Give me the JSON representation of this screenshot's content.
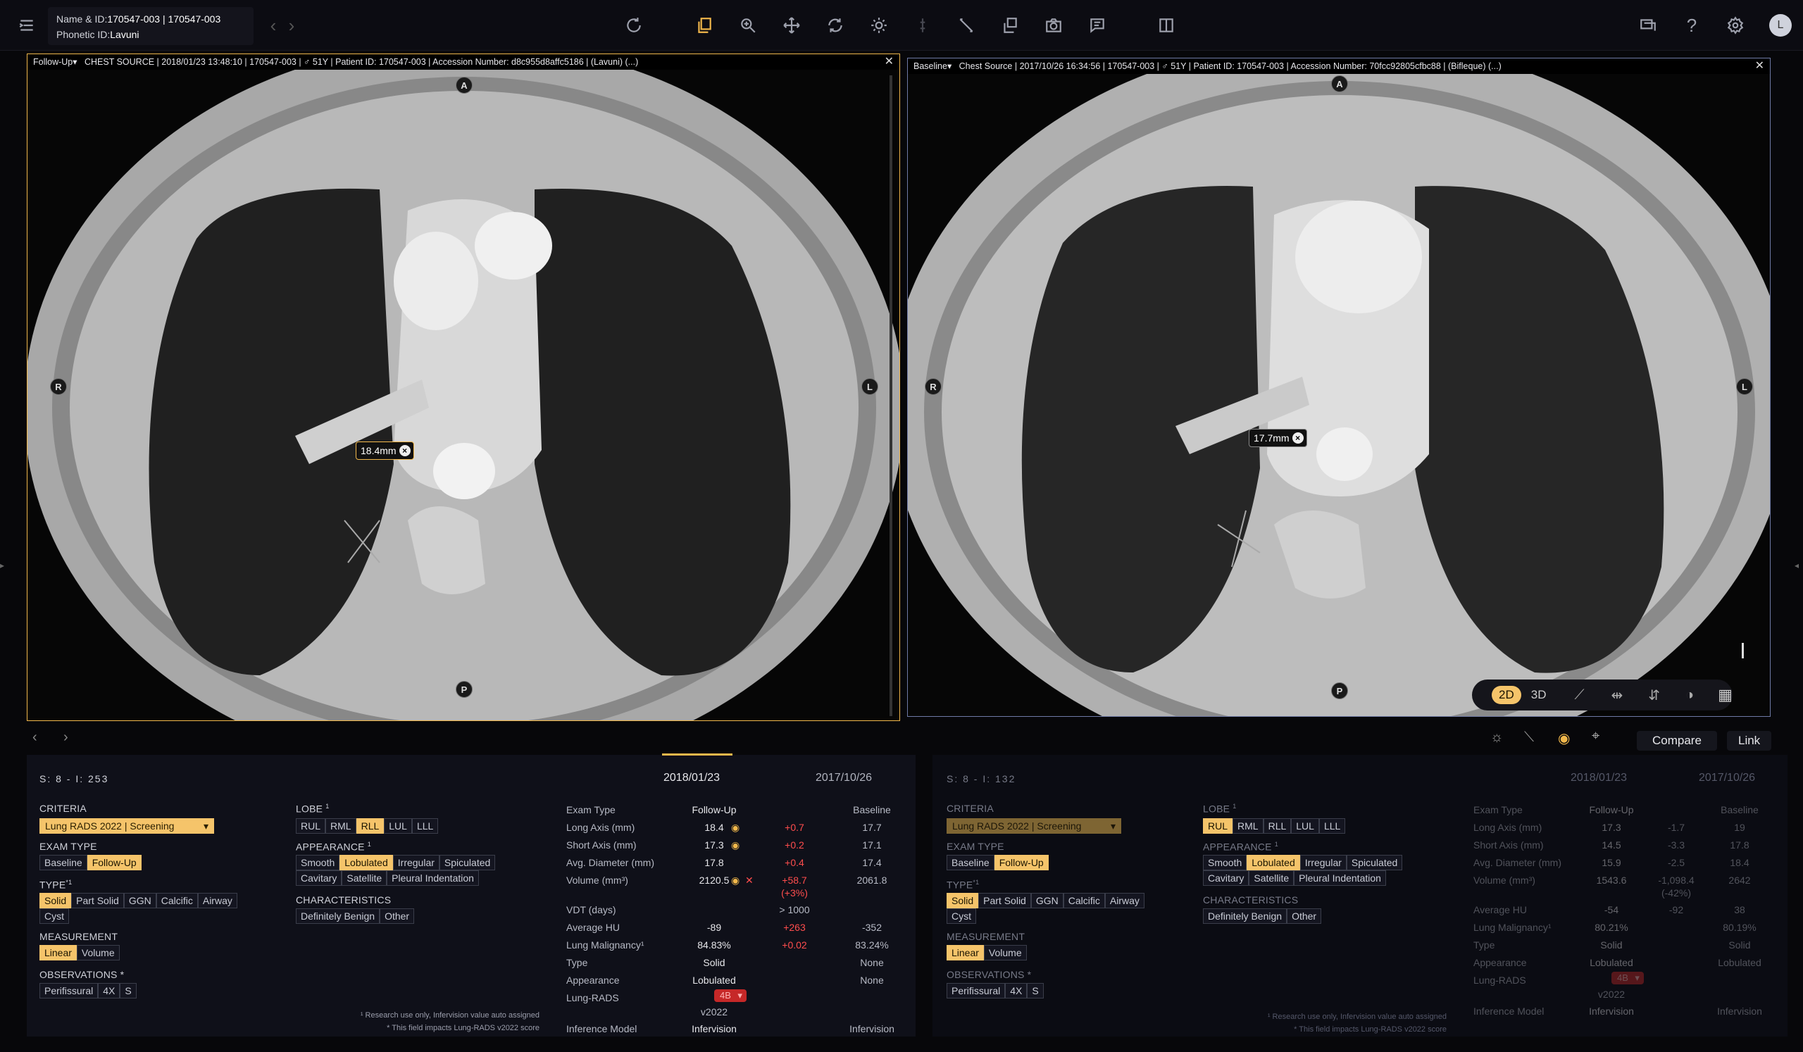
{
  "header": {
    "name_label": "Name & ID:",
    "name_value": "170547-003 | 170547-003",
    "phonetic_label": "Phonetic ID:",
    "phonetic_value": "Lavuni",
    "user_initial": "L"
  },
  "viewers": {
    "left": {
      "tag": "Follow-Up",
      "info": "CHEST SOURCE | 2018/01/23 13:48:10 | 170547-003 | ♂ 51Y | Patient ID: 170547-003 | Accession Number: d8c955d8affc5186 | (Lavuni) (...)",
      "measure": "18.4mm",
      "orient": {
        "top": "A",
        "bottom": "P",
        "left": "R",
        "right": "L"
      }
    },
    "right": {
      "tag": "Baseline",
      "info": "Chest Source | 2017/10/26 16:34:56 | 170547-003 | ♂ 51Y | Patient ID: 170547-003 | Accession Number: 70fcc92805cfbc88 | (Bifleque) (...)",
      "measure": "17.7mm",
      "orient": {
        "top": "A",
        "bottom": "P",
        "left": "R",
        "right": "L"
      }
    },
    "mode_2d": "2D",
    "mode_3d": "3D"
  },
  "bottom_toolbar": {
    "compare": "Compare",
    "link": "Link"
  },
  "panels": {
    "left": {
      "series": "S: 8 - I: 253",
      "criteria_title": "CRITERIA",
      "criteria_value": "Lung RADS 2022 | Screening",
      "exam_title": "EXAM TYPE",
      "exam_options": [
        "Baseline",
        "Follow-Up"
      ],
      "type_title": "TYPE",
      "type_options": [
        "Solid",
        "Part Solid",
        "GGN",
        "Calcific",
        "Airway",
        "Cyst"
      ],
      "measurement_title": "MEASUREMENT",
      "measurement_options": [
        "Linear",
        "Volume"
      ],
      "observations_title": "OBSERVATIONS *",
      "observations_options": [
        "Perifissural",
        "4X",
        "S"
      ],
      "lobe_title": "LOBE",
      "lobe_options": [
        "RUL",
        "RML",
        "RLL",
        "LUL",
        "LLL"
      ],
      "appearance_title": "APPEARANCE",
      "appearance_options": [
        "Smooth",
        "Lobulated",
        "Irregular",
        "Spiculated",
        "Cavitary",
        "Satellite",
        "Pleural Indentation"
      ],
      "char_title": "CHARACTERISTICS",
      "char_options": [
        "Definitely Benign",
        "Other"
      ],
      "footnote1": "¹ Research use only, Infervision value auto assigned",
      "footnote2": "* This field impacts Lung-RADS v2022 score",
      "date_follow": "2018/01/23",
      "date_base": "2017/10/26",
      "rows": [
        {
          "label": "Exam Type",
          "fu": "Follow-Up",
          "delta": "",
          "base": "Baseline"
        },
        {
          "label": "Long Axis (mm)",
          "fu": "18.4",
          "delta": "+0.7",
          "base": "17.7"
        },
        {
          "label": "Short Axis (mm)",
          "fu": "17.3",
          "delta": "+0.2",
          "base": "17.1"
        },
        {
          "label": "Avg. Diameter (mm)",
          "fu": "17.8",
          "delta": "+0.4",
          "base": "17.4"
        },
        {
          "label": "Volume (mm³)",
          "fu": "2120.5",
          "delta": "+58.7",
          "delta2": "(+3%)",
          "base": "2061.8"
        },
        {
          "label": "VDT (days)",
          "fu": "",
          "delta": "> 1000",
          "base": ""
        },
        {
          "label": "Average HU",
          "fu": "-89",
          "delta": "+263",
          "base": "-352"
        },
        {
          "label": "Lung Malignancy¹",
          "fu": "84.83%",
          "delta": "+0.02",
          "base": "83.24%"
        },
        {
          "label": "Type",
          "fu": "Solid",
          "delta": "",
          "base": "None"
        },
        {
          "label": "Appearance",
          "fu": "Lobulated",
          "delta": "",
          "base": "None"
        },
        {
          "label": "Lung-RADS",
          "fu": "4B",
          "fu2": "v2022",
          "delta": "",
          "base": ""
        },
        {
          "label": "Inference Model",
          "fu": "Infervision",
          "delta": "",
          "base": "Infervision"
        }
      ]
    },
    "right": {
      "series": "S: 8 - I: 132",
      "criteria_value": "Lung RADS 2022 | Screening",
      "date_follow": "2018/01/23",
      "date_base": "2017/10/26",
      "rows": [
        {
          "label": "Exam Type",
          "fu": "Follow-Up",
          "delta": "",
          "base": "Baseline"
        },
        {
          "label": "Long Axis (mm)",
          "fu": "17.3",
          "delta": "-1.7",
          "base": "19"
        },
        {
          "label": "Short Axis (mm)",
          "fu": "14.5",
          "delta": "-3.3",
          "base": "17.8"
        },
        {
          "label": "Avg. Diameter (mm)",
          "fu": "15.9",
          "delta": "-2.5",
          "base": "18.4"
        },
        {
          "label": "Volume (mm³)",
          "fu": "1543.6",
          "delta": "-1,098.4",
          "delta2": "(-42%)",
          "base": "2642"
        },
        {
          "label": "Average HU",
          "fu": "-54",
          "delta": "-92",
          "base": "38"
        },
        {
          "label": "Lung Malignancy¹",
          "fu": "80.21%",
          "delta": "",
          "base": "80.19%"
        },
        {
          "label": "Type",
          "fu": "Solid",
          "delta": "",
          "base": "Solid"
        },
        {
          "label": "Appearance",
          "fu": "Lobulated",
          "delta": "",
          "base": "Lobulated"
        },
        {
          "label": "Lung-RADS",
          "fu": "4B",
          "fu2": "v2022",
          "delta": "",
          "base": ""
        },
        {
          "label": "Inference Model",
          "fu": "Infervision",
          "delta": "",
          "base": "Infervision"
        }
      ]
    }
  }
}
